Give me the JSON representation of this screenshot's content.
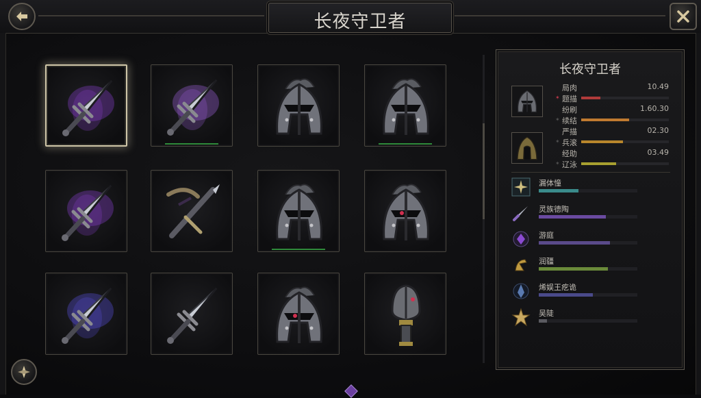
{
  "header": {
    "title": "长夜守卫者"
  },
  "grid": {
    "items": [
      {
        "kind": "sword",
        "glow": "purple",
        "selected": true,
        "underline": false
      },
      {
        "kind": "sword",
        "glow": "purple-light",
        "selected": false,
        "underline": true
      },
      {
        "kind": "helmet",
        "glow": "none",
        "selected": false,
        "underline": false
      },
      {
        "kind": "helmet",
        "glow": "none",
        "selected": false,
        "underline": true
      },
      {
        "kind": "sword",
        "glow": "purple",
        "selected": false,
        "underline": false
      },
      {
        "kind": "crossbow",
        "glow": "none",
        "selected": false,
        "underline": false
      },
      {
        "kind": "helmet",
        "glow": "none",
        "selected": false,
        "underline": true
      },
      {
        "kind": "helmet",
        "glow": "red",
        "selected": false,
        "underline": false
      },
      {
        "kind": "sword",
        "glow": "blue-purple",
        "selected": false,
        "underline": false
      },
      {
        "kind": "sword",
        "glow": "none",
        "selected": false,
        "underline": false
      },
      {
        "kind": "helmet",
        "glow": "red",
        "selected": false,
        "underline": false
      },
      {
        "kind": "mace",
        "glow": "red",
        "selected": false,
        "underline": false
      }
    ]
  },
  "panel": {
    "title": "长夜守卫者",
    "stats": [
      {
        "label": "局肉",
        "value": "10.49",
        "bar_color": "#b03a3a",
        "fill": 0.0
      },
      {
        "label": "题描",
        "value": "",
        "bar_color": "#b03a3a",
        "fill": 0.22
      },
      {
        "label": "纷刷",
        "value": "1.60.30",
        "bar_color": "#c07a30",
        "fill": 0.0
      },
      {
        "label": "续结",
        "value": "",
        "bar_color": "#c07a30",
        "fill": 0.55
      },
      {
        "label": "严描",
        "value": "02.30",
        "bar_color": "#b8862c",
        "fill": 0.0
      },
      {
        "label": "兵滚",
        "value": "",
        "bar_color": "#b8862c",
        "fill": 0.48
      },
      {
        "label": "经助",
        "value": "03.49",
        "bar_color": "#a8a030",
        "fill": 0.0
      },
      {
        "label": "辽泳",
        "value": "",
        "bar_color": "#a8a030",
        "fill": 0.4
      }
    ],
    "skills": [
      {
        "icon": "star-burst-icon",
        "name": "漏体憧",
        "fill": 0.4,
        "color": "#3a8a8a"
      },
      {
        "icon": "dagger-icon",
        "name": "灵族德陶",
        "fill": 0.68,
        "color": "#6a4aa0"
      },
      {
        "icon": "purple-orb-icon",
        "name": "游庭",
        "fill": 0.72,
        "color": "#5a4a8a"
      },
      {
        "icon": "gold-rune-icon",
        "name": "润疆",
        "fill": 0.7,
        "color": "#6a8a3a"
      },
      {
        "icon": "crystal-icon",
        "name": "烯娱王疙诡",
        "fill": 0.55,
        "color": "#4a4a8a"
      },
      {
        "icon": "gold-star-icon",
        "name": "吴陡",
        "fill": 0.08,
        "color": "#5a5a60"
      }
    ]
  },
  "colors": {
    "accent": "#cfc6a8",
    "underline": "#2e8a3a",
    "gem": "#6b3fa0"
  }
}
